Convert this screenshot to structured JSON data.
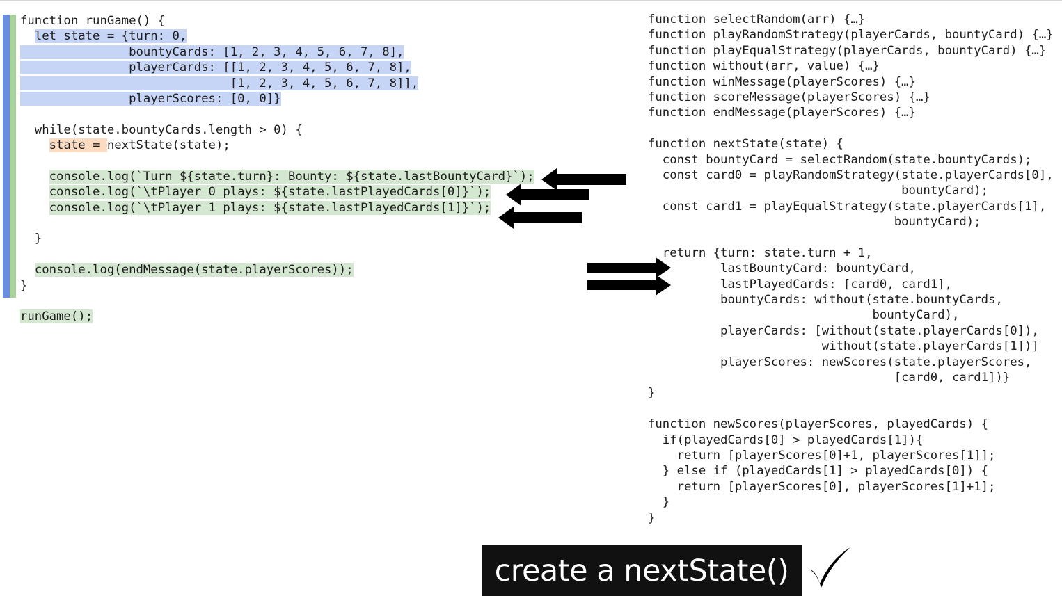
{
  "left_code": [
    "function runGame() {",
    "  let state = {turn: 0,",
    "               bountyCards: [1, 2, 3, 4, 5, 6, 7, 8],",
    "               playerCards: [[1, 2, 3, 4, 5, 6, 7, 8],",
    "                             [1, 2, 3, 4, 5, 6, 7, 8]],",
    "               playerScores: [0, 0]}",
    "",
    "  while(state.bountyCards.length > 0) {",
    "    state = nextState(state);",
    "",
    "    console.log(`Turn ${state.turn}: Bounty: ${state.lastBountyCard}`);",
    "    console.log(`\\tPlayer 0 plays: ${state.lastPlayedCards[0]}`);",
    "    console.log(`\\tPlayer 1 plays: ${state.lastPlayedCards[1]}`);",
    "",
    "  }",
    "",
    "  console.log(endMessage(state.playerScores));",
    "}",
    "",
    "runGame();"
  ],
  "right_code": [
    "function selectRandom(arr) {…}",
    "function playRandomStrategy(playerCards, bountyCard) {…}",
    "function playEqualStrategy(playerCards, bountyCard) {…}",
    "function without(arr, value) {…}",
    "function winMessage(playerScores) {…}",
    "function scoreMessage(playerScores) {…}",
    "function endMessage(playerScores) {…}",
    "",
    "function nextState(state) {",
    "  const bountyCard = selectRandom(state.bountyCards);",
    "  const card0 = playRandomStrategy(state.playerCards[0],",
    "                                   bountyCard);",
    "  const card1 = playEqualStrategy(state.playerCards[1],",
    "                                  bountyCard);",
    "",
    "  return {turn: state.turn + 1,",
    "          lastBountyCard: bountyCard,",
    "          lastPlayedCards: [card0, card1],",
    "          bountyCards: without(state.bountyCards,",
    "                               bountyCard),",
    "          playerCards: [without(state.playerCards[0]),",
    "                        without(state.playerCards[1])]",
    "          playerScores: newScores(state.playerScores,",
    "                                  [card0, card1])}",
    "}",
    "",
    "function newScores(playerScores, playedCards) {",
    "  if(playedCards[0] > playedCards[1]){",
    "    return [playerScores[0]+1, playerScores[1]];",
    "  } else if (playedCards[1] > playedCards[0]) {",
    "    return [playerScores[0], playerScores[1]+1];",
    "  }",
    "}"
  ],
  "banner": {
    "text": "create a nextState()",
    "check_icon": "checkmark-icon"
  },
  "colors": {
    "blue_bar": "#6a8de0",
    "green_bar": "#a9d39c",
    "blue_highlight": "#c6d4f5",
    "green_highlight": "#d4e7d0",
    "orange_highlight": "#fbdcc3",
    "arrow": "#000000"
  }
}
